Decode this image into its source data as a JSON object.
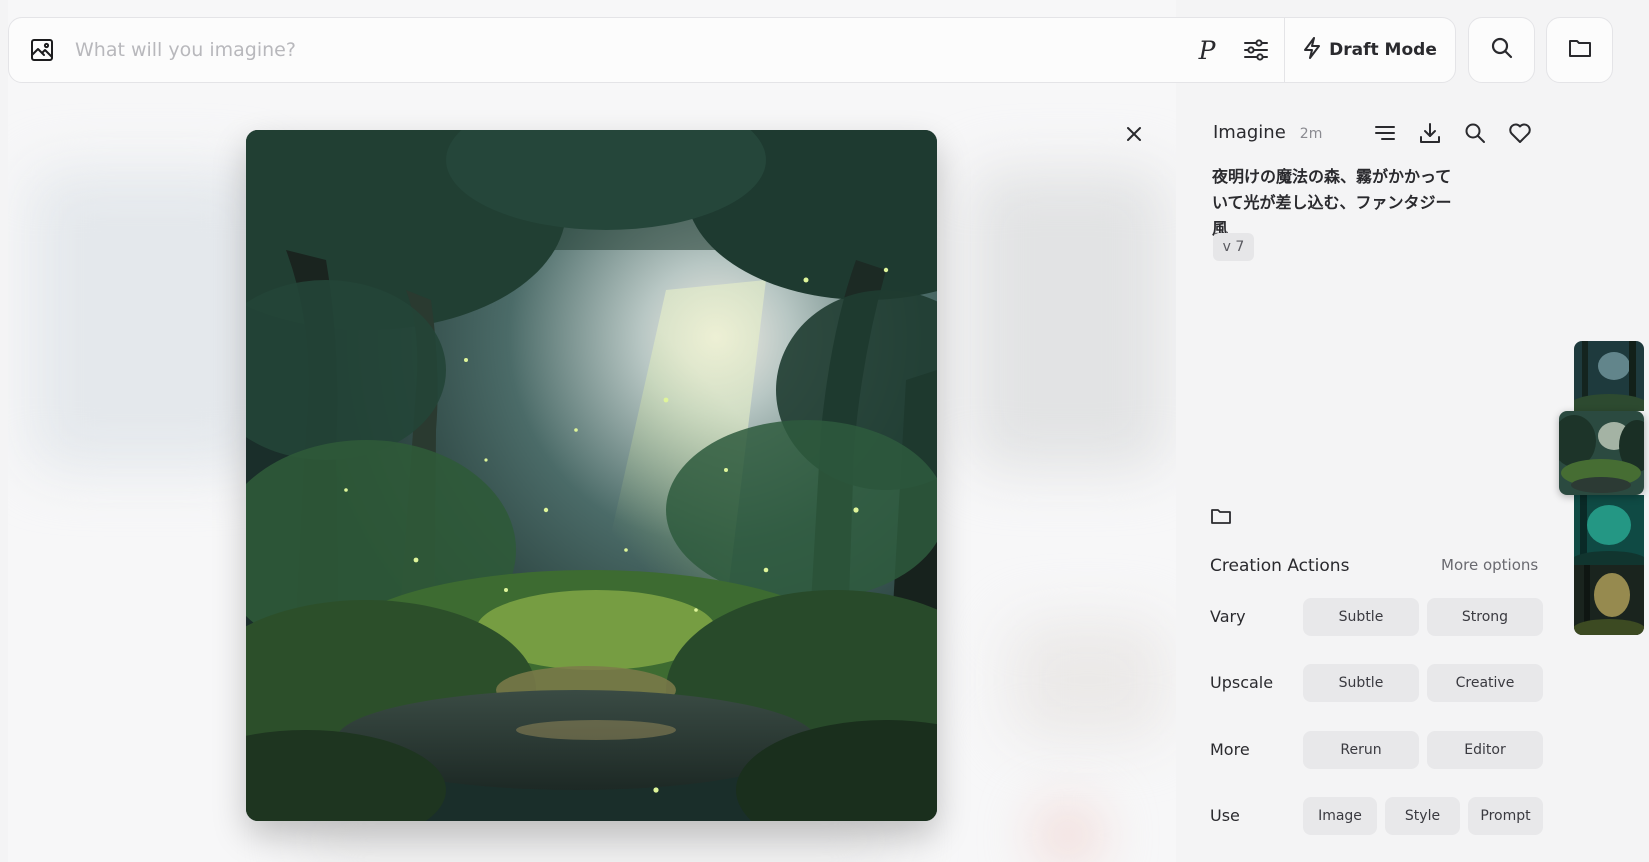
{
  "search": {
    "placeholder": "What will you imagine?",
    "p_label": "P",
    "draft_mode_label": "Draft Mode"
  },
  "detail": {
    "mode": "Imagine",
    "time": "2m",
    "prompt": "夜明けの魔法の森、霧がかかっていて光が差し込む、ファンタジー風",
    "version": "v 7"
  },
  "actions": {
    "title": "Creation Actions",
    "more_options": "More options",
    "rows": [
      {
        "label": "Vary",
        "buttons": [
          "Subtle",
          "Strong"
        ]
      },
      {
        "label": "Upscale",
        "buttons": [
          "Subtle",
          "Creative"
        ]
      },
      {
        "label": "More",
        "buttons": [
          "Rerun",
          "Editor"
        ]
      },
      {
        "label": "Use",
        "buttons": [
          "Image",
          "Style",
          "Prompt"
        ]
      }
    ]
  },
  "icons": [
    "image-icon",
    "sliders-icon",
    "lightning-icon",
    "search-icon",
    "folder-icon",
    "close-icon",
    "list-icon",
    "download-icon",
    "heart-icon"
  ],
  "colors": {
    "panel_bg": "#f4f4f5",
    "button_bg": "#e8e8ea",
    "text": "#1c1c1e"
  }
}
